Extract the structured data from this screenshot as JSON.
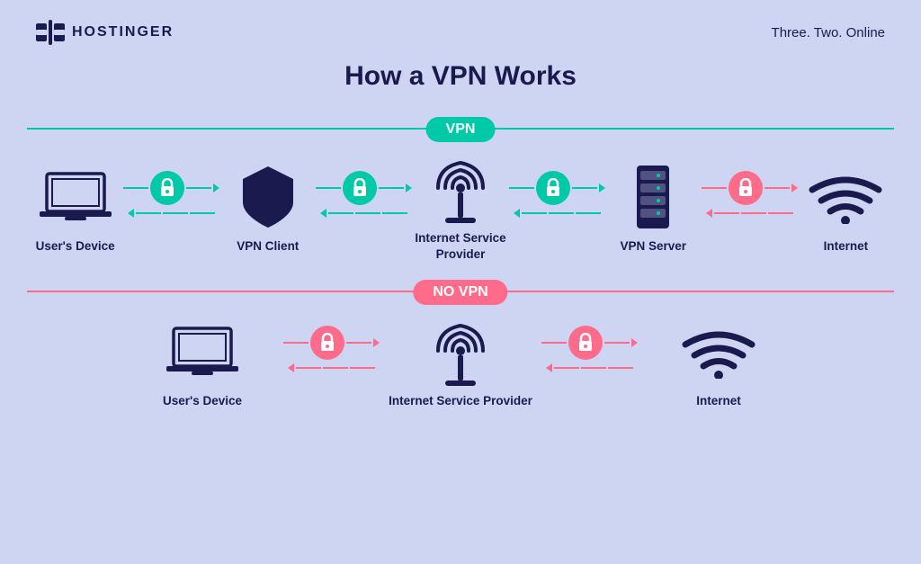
{
  "header": {
    "logo_text": "HOSTINGER",
    "tagline": "Three. Two. Online"
  },
  "main_title": "How a VPN Works",
  "vpn_section": {
    "badge": "VPN",
    "items": [
      {
        "label": "User's Device"
      },
      {
        "label": "VPN Client"
      },
      {
        "label": "Internet Service Provider"
      },
      {
        "label": "VPN Server"
      },
      {
        "label": "Internet"
      }
    ],
    "connector_color": "green"
  },
  "novpn_section": {
    "badge": "NO VPN",
    "items": [
      {
        "label": "User's Device"
      },
      {
        "label": "Internet Service Provider"
      },
      {
        "label": "Internet"
      }
    ],
    "connector_color": "red"
  }
}
